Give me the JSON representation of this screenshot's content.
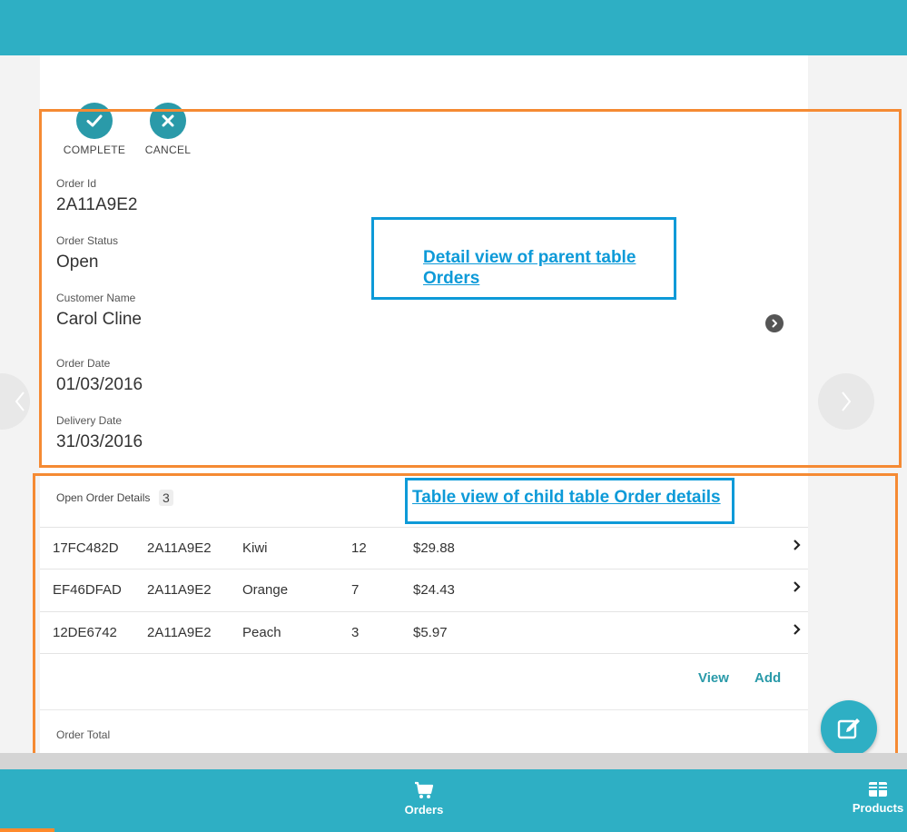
{
  "actions": {
    "complete_label": "COMPLETE",
    "cancel_label": "CANCEL"
  },
  "fields": [
    {
      "label": "Order Id",
      "value": "2A11A9E2"
    },
    {
      "label": "Order Status",
      "value": "Open"
    },
    {
      "label": "Customer Name",
      "value": "Carol Cline"
    },
    {
      "label": "Order Date",
      "value": "01/03/2016"
    },
    {
      "label": "Delivery Date",
      "value": "31/03/2016"
    }
  ],
  "annotations": {
    "detail_line1": "Detail view of parent table",
    "detail_line2": "Orders",
    "table": "Table view of child table Order details"
  },
  "order_details": {
    "title": "Open Order Details",
    "count": "3",
    "rows": [
      {
        "id": "17FC482D",
        "order": "2A11A9E2",
        "product": "Kiwi",
        "qty": "12",
        "price": "$29.88"
      },
      {
        "id": "EF46DFAD",
        "order": "2A11A9E2",
        "product": "Orange",
        "qty": "7",
        "price": "$24.43"
      },
      {
        "id": "12DE6742",
        "order": "2A11A9E2",
        "product": "Peach",
        "qty": "3",
        "price": "$5.97"
      }
    ],
    "view_label": "View",
    "add_label": "Add"
  },
  "order_total_label": "Order Total",
  "bottom_nav": {
    "orders_label": "Orders",
    "products_label": "Products"
  },
  "colors": {
    "teal": "#2eafc4",
    "orange_box": "#f58a33",
    "blue_box": "#0d9ad8"
  },
  "icons": [
    "check-icon",
    "close-icon",
    "chevron-right-icon",
    "edit-icon",
    "cart-icon",
    "grid-icon"
  ]
}
